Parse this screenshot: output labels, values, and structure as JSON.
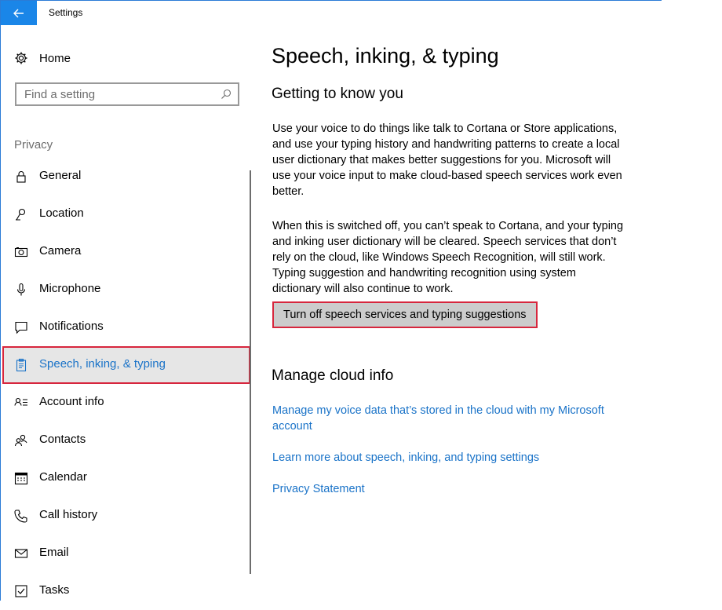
{
  "window": {
    "title": "Settings"
  },
  "sidebar": {
    "home_label": "Home",
    "search_placeholder": "Find a setting",
    "section_label": "Privacy",
    "items": [
      {
        "label": "General",
        "icon": "lock-icon"
      },
      {
        "label": "Location",
        "icon": "location-pin-icon"
      },
      {
        "label": "Camera",
        "icon": "camera-icon"
      },
      {
        "label": "Microphone",
        "icon": "microphone-icon"
      },
      {
        "label": "Notifications",
        "icon": "notification-icon"
      },
      {
        "label": "Speech, inking, & typing",
        "icon": "clipboard-icon",
        "selected": true
      },
      {
        "label": "Account info",
        "icon": "account-info-icon"
      },
      {
        "label": "Contacts",
        "icon": "contacts-icon"
      },
      {
        "label": "Calendar",
        "icon": "calendar-icon"
      },
      {
        "label": "Call history",
        "icon": "call-history-icon"
      },
      {
        "label": "Email",
        "icon": "email-icon"
      },
      {
        "label": "Tasks",
        "icon": "tasks-icon"
      }
    ]
  },
  "main": {
    "title": "Speech, inking, & typing",
    "section1_heading": "Getting to know you",
    "paragraph1": "Use your voice to do things like talk to Cortana or Store applications, and use your typing history and handwriting patterns to create a local user dictionary that makes better suggestions for you. Microsoft will use your voice input to make cloud-based speech services work even better.",
    "paragraph2": "When this is switched off, you can’t speak to Cortana, and your typing and inking user dictionary will be cleared. Speech services that don’t rely on the cloud, like Windows Speech Recognition, will still work. Typing suggestion and handwriting recognition using system dictionary will also continue to work.",
    "toggle_button": "Turn off speech services and typing suggestions",
    "section2_heading": "Manage cloud info",
    "link_manage_voice": "Manage my voice data that’s stored in the cloud with my Microsoft account",
    "link_learn_more": "Learn more about speech, inking, and typing settings",
    "link_privacy": "Privacy Statement"
  },
  "colors": {
    "accent": "#1a86e8",
    "link": "#1a73c8",
    "highlight_border": "#d7263d"
  }
}
